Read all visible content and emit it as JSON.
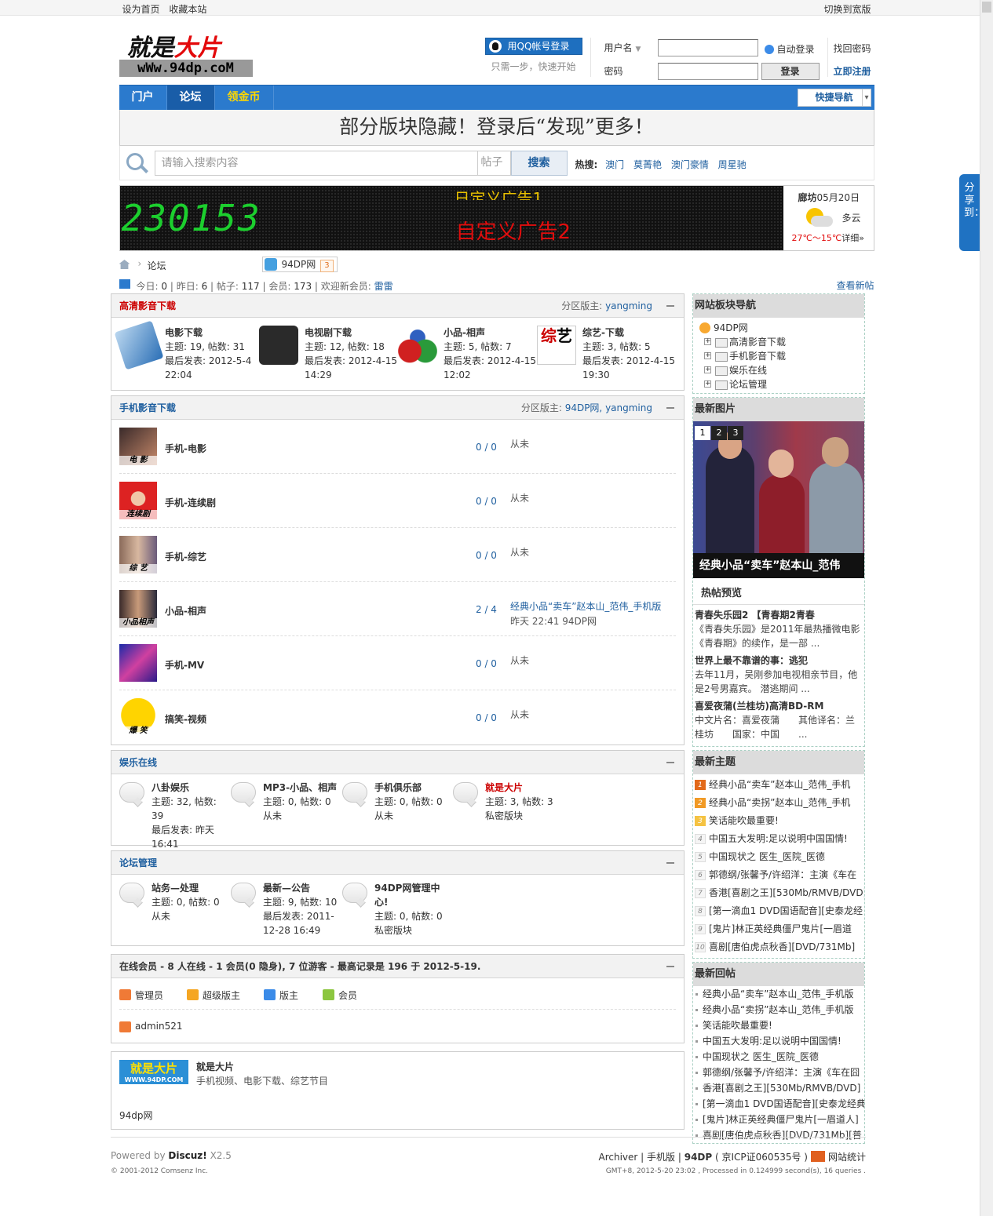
{
  "topbar": {
    "set_home": "设为首页",
    "bookmark": "收藏本站",
    "wide": "切换到宽版"
  },
  "share": "分享到：",
  "logo": {
    "line1a": "就是",
    "line1b": "大片",
    "line2": "wWw.94dp.coM"
  },
  "login": {
    "qq_button": "用QQ帐号登录",
    "qq_tip": "只需一步，快速开始",
    "username_label": "用户名",
    "password_label": "密码",
    "auto_login": "自动登录",
    "login_button": "登录",
    "forgot": "找回密码",
    "register": "立即注册"
  },
  "nav": {
    "items": [
      "门户",
      "论坛",
      "领金币"
    ],
    "quick": "快捷导航"
  },
  "banner": "部分版块隐藏！登录后“发现”更多！",
  "search": {
    "placeholder": "请输入搜索内容",
    "type": "帖子",
    "button": "搜索",
    "hot_label": "热搜:",
    "hot": [
      "澳门",
      "莫菁艳",
      "澳门豪情",
      "周星驰"
    ]
  },
  "ad": {
    "digits": "230153",
    "top_text": "日定义广告1",
    "text": "自定义广告2"
  },
  "weather": {
    "city": "廊坊",
    "date": "05月20日",
    "cond": "多云",
    "temp": "27℃～15℃",
    "detail": "详细»"
  },
  "breadcrumb": {
    "forum": "论坛",
    "site": "94DP网",
    "badge": "3"
  },
  "stats": {
    "today_label": "今日:",
    "today": "0",
    "yesterday_label": "昨日:",
    "yesterday": "6",
    "posts_label": "帖子:",
    "posts": "117",
    "members_label": "会员:",
    "members": "173",
    "welcome": "欢迎新会员:",
    "newest": "雷雷",
    "new_posts": "查看新帖"
  },
  "sections": {
    "hd": {
      "title": "高清影音下载",
      "mods_label": "分区版主:",
      "mods": "yangming",
      "forums": [
        {
          "name": "电影下载",
          "stats": "主题: 19, 帖数: 31",
          "last": "最后发表: 2012-5-4 22:04"
        },
        {
          "name": "电视剧下载",
          "stats": "主题: 12, 帖数: 18",
          "last": "最后发表: 2012-4-15 14:29"
        },
        {
          "name": "小品-相声",
          "stats": "主题: 5, 帖数: 7",
          "last": "最后发表: 2012-4-15 12:02"
        },
        {
          "name": "综艺-下载",
          "stats": "主题: 3, 帖数: 5",
          "last": "最后发表: 2012-4-15 19:30"
        }
      ]
    },
    "mobile": {
      "title": "手机影音下载",
      "mods_label": "分区版主:",
      "mods": "94DP网, yangming",
      "forums": [
        {
          "name": "手机-电影",
          "cap": "电 影",
          "count": "0 / 0",
          "last": "从未",
          "last_time": ""
        },
        {
          "name": "手机-连续剧",
          "cap": "连续剧",
          "count": "0 / 0",
          "last": "从未",
          "last_time": ""
        },
        {
          "name": "手机-综艺",
          "cap": "综 艺",
          "count": "0 / 0",
          "last": "从未",
          "last_time": ""
        },
        {
          "name": "小品-相声",
          "cap": "小品相声",
          "count": "2 / 4",
          "last": "经典小品“卖车”赵本山_范伟_手机版",
          "last_time": "昨天 22:41 94DP网"
        },
        {
          "name": "手机-MV",
          "cap": "",
          "count": "0 / 0",
          "last": "从未",
          "last_time": ""
        },
        {
          "name": "搞笑-视频",
          "cap": "爆 笑",
          "count": "0 / 0",
          "last": "从未",
          "last_time": ""
        }
      ]
    },
    "ent": {
      "title": "娱乐在线",
      "forums": [
        {
          "name": "八卦娱乐",
          "l1": "主题: 32, 帖数: 39",
          "l2": "最后发表: 昨天 16:41",
          "red": false
        },
        {
          "name": "MP3-小品、相声",
          "l1": "主题: 0, 帖数: 0",
          "l2": "从未",
          "red": false
        },
        {
          "name": "手机俱乐部",
          "l1": "主题: 0, 帖数: 0",
          "l2": "从未",
          "red": false
        },
        {
          "name": "就是大片",
          "l1": "主题: 3, 帖数: 3",
          "l2": "私密版块",
          "red": true
        }
      ]
    },
    "admin": {
      "title": "论坛管理",
      "forums": [
        {
          "name": "站务—处理",
          "l1": "主题: 0, 帖数: 0",
          "l2": "从未"
        },
        {
          "name": "最新—公告",
          "l1": "主题: 9, 帖数: 10",
          "l2": "最后发表: 2011-12-28 16:49"
        },
        {
          "name": "94DP网管理中心!",
          "l1": "主题: 0, 帖数: 0",
          "l2": "私密版块"
        }
      ]
    }
  },
  "online": {
    "title": "在线会员 - 8 人在线 - 1 会员(0 隐身), 7 位游客 - 最高记录是 196 于 2012-5-19.",
    "legend": [
      "管理员",
      "超级版主",
      "版主",
      "会员"
    ],
    "legend_colors": [
      "#f07a36",
      "#f5a623",
      "#3b8be8",
      "#8cc63f"
    ],
    "users": [
      "admin521"
    ]
  },
  "link": {
    "logo_text": "就是大片",
    "logo_url": "WWW.94DP.COM",
    "name": "就是大片",
    "desc": "手机视频、电影下载、综艺节目",
    "footer": "94dp网"
  },
  "footer": {
    "powered": "Powered by",
    "discuz": "Discuz!",
    "ver": "X2.5",
    "copyright": "© 2001-2012 Comsenz Inc.",
    "archiver": "Archiver",
    "mobile": "手机版",
    "site": "94DP",
    "icp": "( 京ICP证060535号 )",
    "stat": "网站统计",
    "gmt": "GMT+8, 2012-5-20 23:02 , Processed in 0.124999 second(s), 16 queries ."
  },
  "sidebar": {
    "nav_title": "网站板块导航",
    "nav_root": "94DP网",
    "nav_nodes": [
      "高清影音下载",
      "手机影音下载",
      "娱乐在线",
      "论坛管理"
    ],
    "pics_title": "最新图片",
    "pic_nums": [
      "1",
      "2",
      "3"
    ],
    "pic_caption": "经典小品“卖车”赵本山_范伟",
    "hot_title": "热帖预览",
    "hot_items": [
      {
        "title": "青春失乐园2 【青春期2青春",
        "desc": "《青春失乐园》是2011年最热播微电影《青春期》的续作，是一部 ..."
      },
      {
        "title": "世界上最不靠谱的事：逃犯",
        "desc": "去年11月，吴刚参加电视相亲节目，他是2号男嘉宾。 潜逃期间 ..."
      },
      {
        "title": "喜爱夜蒲(兰桂坊)高清BD-RM",
        "desc": "中文片名：喜爱夜蒲　　其他译名：兰桂坊　　国家：中国　　..."
      }
    ],
    "new_title": "最新主题",
    "new_items": [
      "经典小品“卖车”赵本山_范伟_手机",
      "经典小品“卖拐”赵本山_范伟_手机",
      "笑话能吹最重要!",
      "中国五大发明:足以说明中国国情!",
      "中国现状之 医生_医院_医德",
      "郭德纲/张馨予/许绍洋：主演《车在",
      "香港[喜剧之王][530Mb/RMVB/DVD]",
      "[第一滴血1 DVD国语配音][史泰龙经",
      "[鬼片]林正英经典僵尸鬼片[一眉道",
      "喜剧[唐伯虎点秋香][DVD/731Mb]"
    ],
    "new_ranks": [
      "1",
      "2",
      "3",
      "4",
      "5",
      "6",
      "7",
      "8",
      "9",
      "10"
    ],
    "reply_title": "最新回帖",
    "reply_items": [
      "经典小品“卖车”赵本山_范伟_手机版",
      "经典小品“卖拐”赵本山_范伟_手机版",
      "笑话能吹最重要!",
      "中国五大发明:足以说明中国国情!",
      "中国现状之 医生_医院_医德",
      "郭德纲/张馨予/许绍洋：主演《车在囧",
      "香港[喜剧之王][530Mb/RMVB/DVD]",
      "[第一滴血1 DVD国语配音][史泰龙经典",
      "[鬼片]林正英经典僵尸鬼片[一眉道人]",
      "喜剧[唐伯虎点秋香][DVD/731Mb][普"
    ]
  }
}
